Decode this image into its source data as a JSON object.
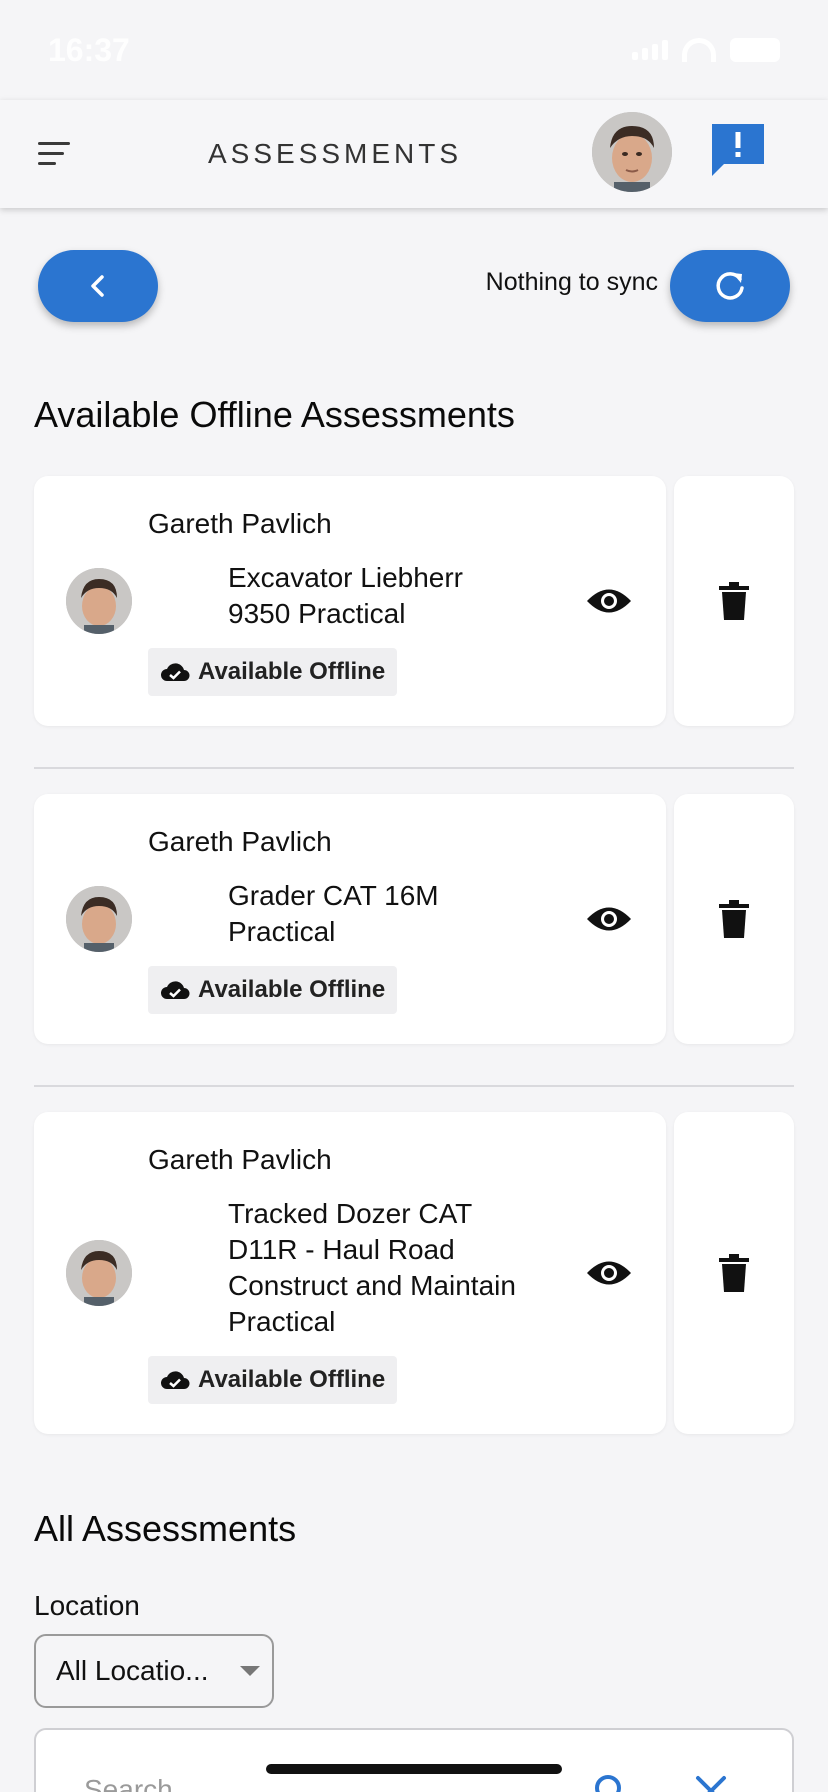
{
  "status_bar": {
    "time": "16:37"
  },
  "header": {
    "title": "ASSESSMENTS"
  },
  "sync": {
    "status_text": "Nothing to sync"
  },
  "offline_section": {
    "title": "Available Offline Assessments",
    "items": [
      {
        "person": "Gareth Pavlich",
        "assessment": "Excavator Liebherr 9350 Practical",
        "badge": "Available Offline"
      },
      {
        "person": "Gareth Pavlich",
        "assessment": "Grader CAT 16M Practical",
        "badge": "Available Offline"
      },
      {
        "person": "Gareth Pavlich",
        "assessment": "Tracked Dozer CAT D11R - Haul Road Construct and Maintain Practical",
        "badge": "Available Offline"
      }
    ]
  },
  "all_section": {
    "title": "All Assessments",
    "location_label": "Location",
    "location_value": "All Locatio...",
    "search_placeholder": "Search"
  },
  "colors": {
    "accent": "#2b75d0",
    "background": "#f5f5f7",
    "card": "#ffffff"
  }
}
